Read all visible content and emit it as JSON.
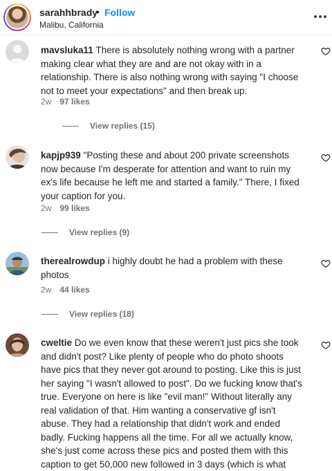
{
  "header": {
    "username": "sarahhbrady",
    "separator": "•",
    "follow_label": "Follow",
    "location": "Malibu, California",
    "more_icon": "more-horizontal-icon"
  },
  "comments": [
    {
      "username": "mavsluka11",
      "text": "There is absolutely nothing wrong with a partner making clear what they are and are not okay with in a relationship. There is also nothing wrong with saying \"I choose not to meet your expectations\" and then break up.",
      "time": "2w",
      "likes": "97 likes",
      "replies": "View replies (15)"
    },
    {
      "username": "kapjp939",
      "text": "\"Posting these and about 200 private screenshots now because I'm desperate for attention and want to ruin my ex's life because he left me and started a family.\" There, I fixed your caption for you.",
      "time": "2w",
      "likes": "99 likes",
      "replies": "View replies (9)"
    },
    {
      "username": "therealrowdup",
      "text": "i highly doubt he had a problem with these photos",
      "time": "2w",
      "likes": "44 likes",
      "replies": "View replies (18)"
    },
    {
      "username": "cweltie",
      "text": "Do we even know that these weren't just pics she took and didn't post? Like plenty of people who do photo shoots have pics that they never got around to posting. Like this is just her saying \"I wasn't allowed to post\". Do we fucking know that's true. Everyone on here is like \"evil man!\" Without literally any real validation of that. Him wanting a conservative gf isn't abuse. They had a relationship that didn't work and ended badly. Fucking happens all the time. For all we actually know, she's just come across these pics and posted them with this caption to get 50,000 new followed in 3 days (which is what",
      "time": "",
      "likes": "",
      "replies": ""
    }
  ]
}
